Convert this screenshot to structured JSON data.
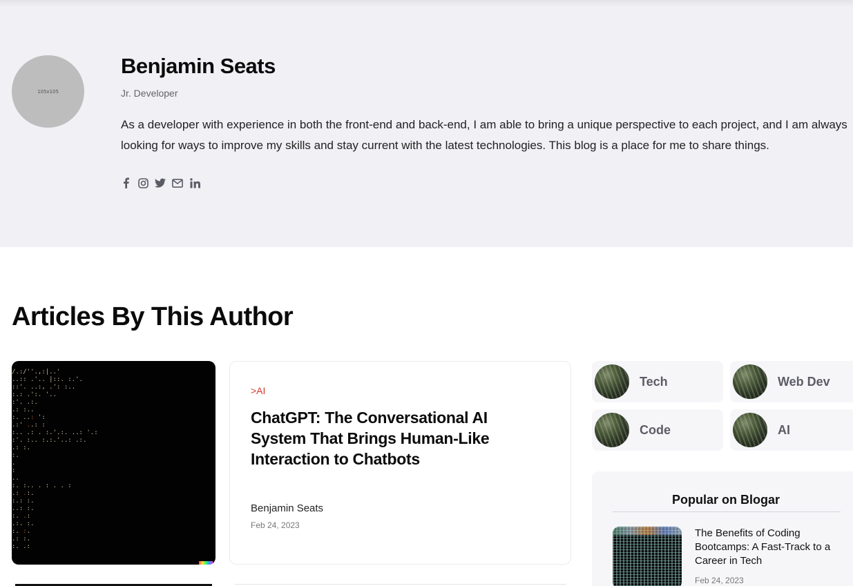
{
  "author": {
    "avatar_placeholder": "105x105",
    "name": "Benjamin Seats",
    "role": "Jr. Developer",
    "bio": "As a developer with experience in both the front-end and back-end, I am able to bring a unique perspective to each project, and I am always looking for ways to improve my skills and stay current with the latest technologies. This blog is a place for me to share things.",
    "social_icons": [
      "facebook-icon",
      "instagram-icon",
      "twitter-icon",
      "email-icon",
      "linkedin-icon"
    ]
  },
  "articles_section": {
    "title": "Articles By This Author"
  },
  "article": {
    "category": ">AI",
    "title": "ChatGPT: The Conversational AI System That Brings Human-Like Interaction to Chatbots",
    "author": "Benjamin Seats",
    "date": "Feb 24, 2023"
  },
  "categories": [
    {
      "label": "Tech"
    },
    {
      "label": "Web Dev"
    },
    {
      "label": "Code"
    },
    {
      "label": "AI"
    }
  ],
  "popular": {
    "title": "Popular on Blogar",
    "items": [
      {
        "title": "The Benefits of Coding Bootcamps: A Fast-Track to a Career in Tech",
        "date": "Feb 24, 2023"
      }
    ]
  },
  "colors": {
    "author_bg": "#f0f0f5",
    "category_accent": "#d43a2f",
    "chip_bg": "#f6f6f9"
  }
}
